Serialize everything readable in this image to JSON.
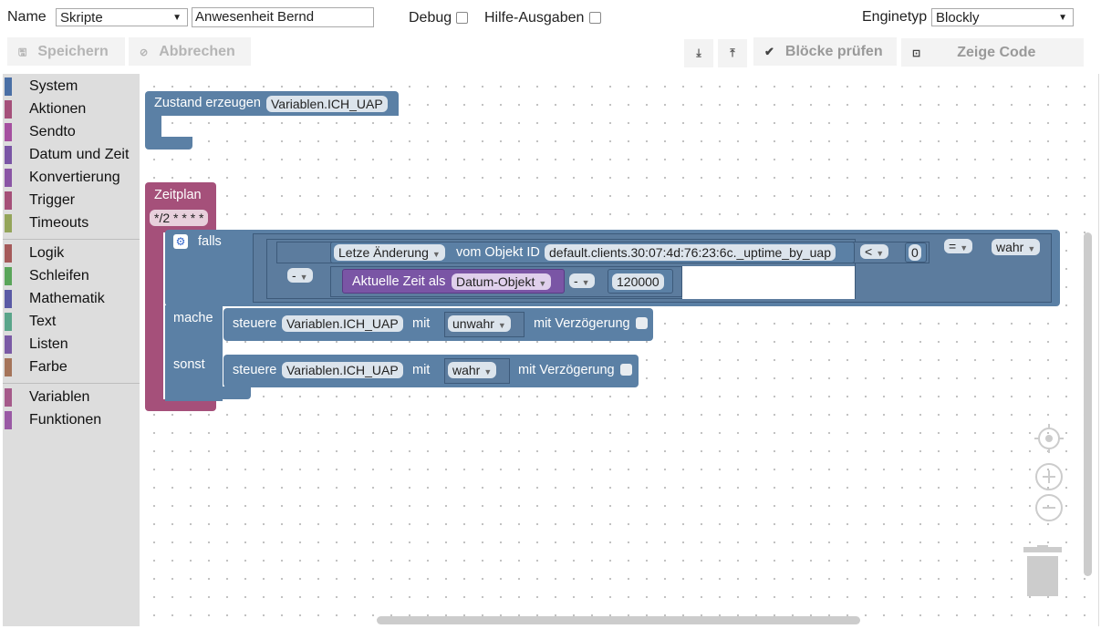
{
  "toolbar": {
    "name_label": "Name",
    "name_select": "Skripte",
    "name_input": "Anwesenheit Bernd",
    "debug_label": "Debug",
    "help_label": "Hilfe-Ausgaben",
    "engine_label": "Enginetyp",
    "engine_select": "Blockly",
    "save_label": "Speichern",
    "cancel_label": "Abbrechen",
    "check_blocks_label": "Blöcke prüfen",
    "show_code_label": "Zeige Code"
  },
  "sidebar": {
    "items": [
      {
        "label": "System",
        "color": "#4a6fa5"
      },
      {
        "label": "Aktionen",
        "color": "#a5507a"
      },
      {
        "label": "Sendto",
        "color": "#a550a0"
      },
      {
        "label": "Datum und Zeit",
        "color": "#7a55a5"
      },
      {
        "label": "Konvertierung",
        "color": "#8a55a5"
      },
      {
        "label": "Trigger",
        "color": "#a55078"
      },
      {
        "label": "Timeouts",
        "color": "#94a55a"
      },
      {
        "label": "Logik",
        "color": "#a55a5a"
      },
      {
        "label": "Schleifen",
        "color": "#5aa55a"
      },
      {
        "label": "Mathematik",
        "color": "#5a5aa5"
      },
      {
        "label": "Text",
        "color": "#5aa58a"
      },
      {
        "label": "Listen",
        "color": "#7a5aa5"
      },
      {
        "label": "Farbe",
        "color": "#a5745a"
      },
      {
        "label": "Variablen",
        "color": "#a55a8a"
      },
      {
        "label": "Funktionen",
        "color": "#9a5aa5"
      }
    ]
  },
  "blocks": {
    "state_create": "Zustand erzeugen",
    "state_var": "Variablen.ICH_UAP",
    "schedule_label": "Zeitplan",
    "schedule_cron": "*/2 * * * *",
    "if_label": "falls",
    "do_label": "mache",
    "else_label": "sonst",
    "last_change": "Letze Änderung",
    "from_object": "vom Objekt ID",
    "object_id": "default.clients.30:07:4d:76:23:6c._uptime_by_uap",
    "lt_op": "<",
    "zero": "0",
    "eq_op": "=",
    "true_val": "wahr",
    "minus_op": "-",
    "current_time": "Aktuelle Zeit als",
    "date_object": "Datum-Objekt",
    "minus_op2": "-",
    "number_120000": "120000",
    "control1": "steuere",
    "var1": "Variablen.ICH_UAP",
    "with1": "mit",
    "val_false": "unwahr",
    "delay1": "mit Verzögerung",
    "control2": "steuere",
    "var2": "Variablen.ICH_UAP",
    "with2": "mit",
    "val_true": "wahr",
    "delay2": "mit Verzögerung"
  },
  "colors": {
    "system_block": "#5b80a5",
    "trigger_block": "#a5507a",
    "logic_block": "#5b80a5",
    "datetime_block": "#7a55a5"
  }
}
